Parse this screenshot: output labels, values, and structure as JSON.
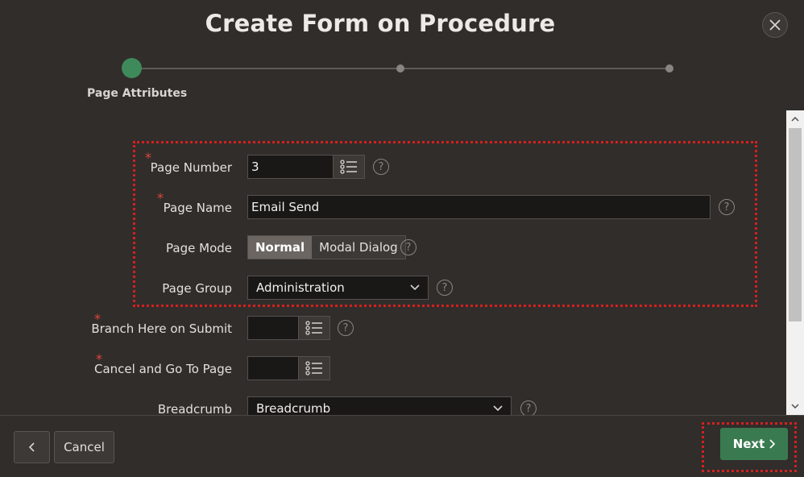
{
  "dialog": {
    "title": "Create Form on Procedure"
  },
  "wizard": {
    "current_step_label": "Page Attributes",
    "accent_color": "#3e8a5a"
  },
  "form": {
    "page_number": {
      "label": "Page Number",
      "value": "3",
      "required": true
    },
    "page_name": {
      "label": "Page Name",
      "value": "Email Send",
      "required": true
    },
    "page_mode": {
      "label": "Page Mode",
      "options": [
        "Normal",
        "Modal Dialog"
      ],
      "selected": "Normal"
    },
    "page_group": {
      "label": "Page Group",
      "value": "Administration"
    },
    "branch_here": {
      "label": "Branch Here on Submit",
      "value": "",
      "required": true
    },
    "cancel_goto": {
      "label": "Cancel and Go To Page",
      "value": "",
      "required": true
    },
    "breadcrumb": {
      "label": "Breadcrumb",
      "value": "Breadcrumb"
    }
  },
  "footer": {
    "cancel_label": "Cancel",
    "next_label": "Next"
  },
  "icons": {
    "required_marker": "*",
    "help": "?"
  }
}
